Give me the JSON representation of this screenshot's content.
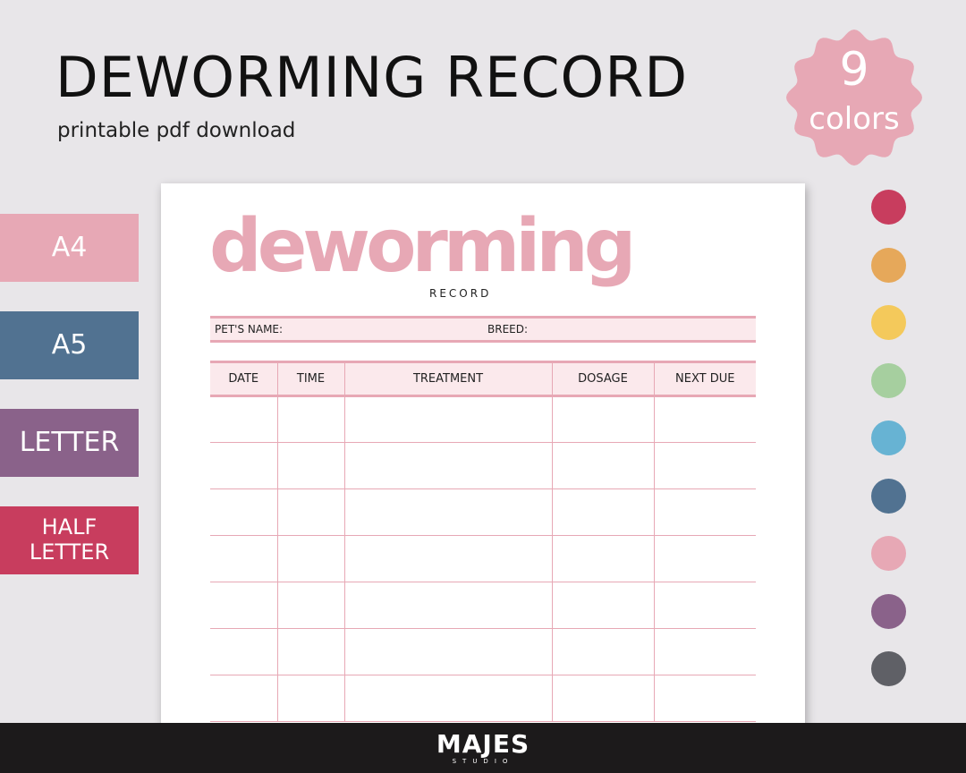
{
  "header": {
    "title": "DEWORMING RECORD",
    "subtitle": "printable pdf download"
  },
  "badge": {
    "number": "9",
    "word": "colors",
    "color": "#e7a8b5"
  },
  "sizes": [
    {
      "label": "A4",
      "color": "#e7a8b5"
    },
    {
      "label": "A5",
      "color": "#517291"
    },
    {
      "label": "LETTER",
      "color": "#8a628a"
    },
    {
      "label_line1": "HALF",
      "label_line2": "LETTER",
      "color": "#c83d5e"
    }
  ],
  "swatches": [
    {
      "name": "crimson",
      "color": "#c83d5e"
    },
    {
      "name": "orange",
      "color": "#e6a85a"
    },
    {
      "name": "yellow",
      "color": "#f4c95b"
    },
    {
      "name": "green",
      "color": "#a6cf9f"
    },
    {
      "name": "sky-blue",
      "color": "#67b3d3"
    },
    {
      "name": "slate-blue",
      "color": "#517291"
    },
    {
      "name": "pink",
      "color": "#e7a8b5"
    },
    {
      "name": "purple",
      "color": "#8a628a"
    },
    {
      "name": "gray",
      "color": "#5f6066"
    }
  ],
  "document": {
    "title": "deworming",
    "subtitle": "RECORD",
    "pet_name_label": "PET'S NAME:",
    "breed_label": "BREED:",
    "columns": [
      "DATE",
      "TIME",
      "TREATMENT",
      "DOSAGE",
      "NEXT DUE"
    ],
    "accent": "#e7a8b5",
    "fill": "#fbe9ec"
  },
  "footer": {
    "brand": "MAJES",
    "brand_sub": "STUDIO"
  }
}
